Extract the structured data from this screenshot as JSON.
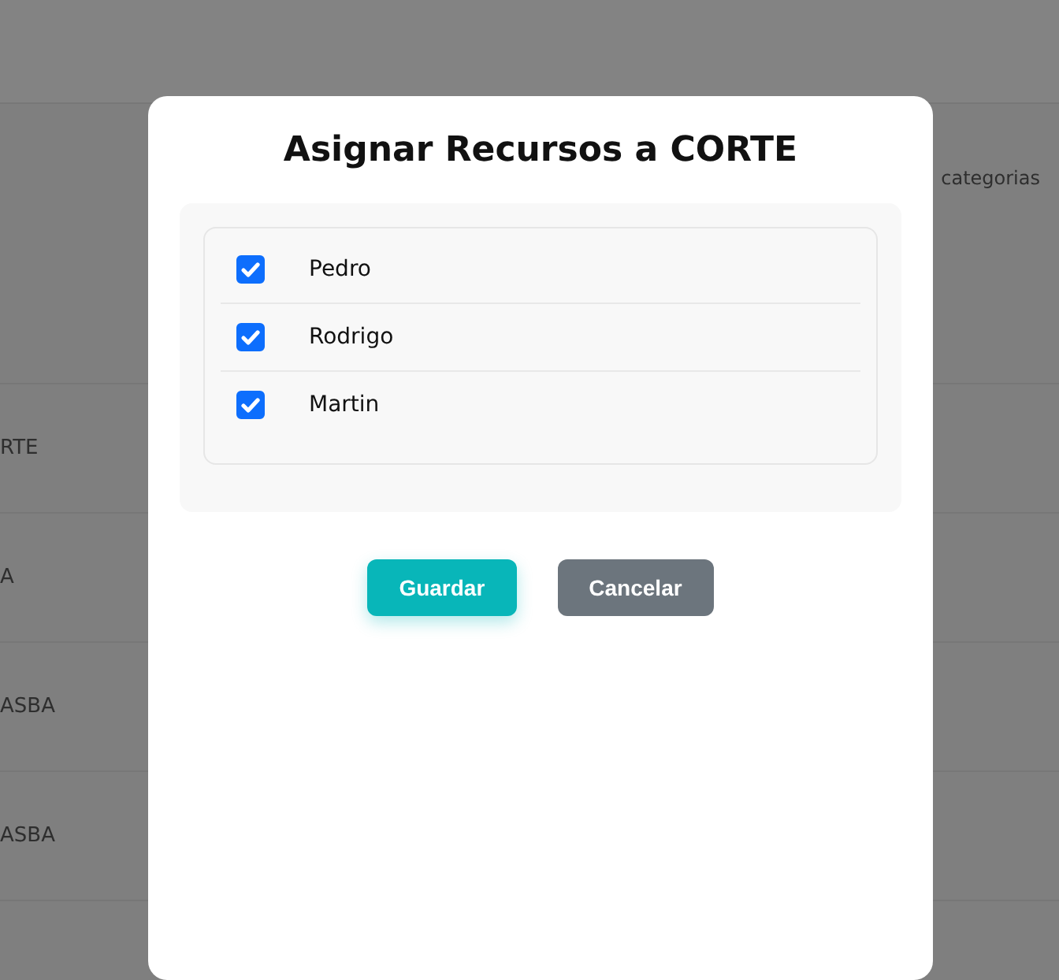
{
  "background_table": {
    "header_text": "categorias",
    "rows": [
      {
        "column_1": "RTE"
      },
      {
        "column_1": "A"
      },
      {
        "column_1": "ASBA"
      },
      {
        "column_1": "ASBA"
      }
    ]
  },
  "dialog": {
    "title": "Asignar Recursos a CORTE",
    "resources": [
      {
        "name": "Pedro",
        "checked": true
      },
      {
        "name": "Rodrigo",
        "checked": true
      },
      {
        "name": "Martin",
        "checked": true
      }
    ],
    "buttons": [
      {
        "label": "Guardar",
        "kind": "primary"
      },
      {
        "label": "Cancelar",
        "kind": "secondary"
      }
    ]
  }
}
